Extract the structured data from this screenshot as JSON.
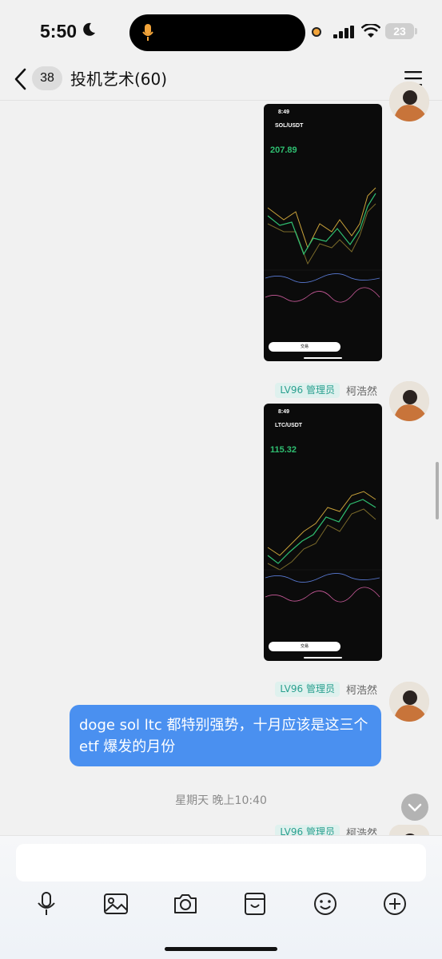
{
  "status": {
    "time": "5:50",
    "battery": "23"
  },
  "nav": {
    "unread": "38",
    "title": "投机艺术(60)"
  },
  "messages": {
    "sender_name": "柯浩然",
    "role": "LV96 管理员",
    "img1": {
      "time": "8:49",
      "pair": "SOL/USDT",
      "price": "207.89",
      "button": "交易"
    },
    "img2": {
      "time": "8:49",
      "pair": "LTC/USDT",
      "price": "115.32",
      "button": "交易"
    },
    "text": "doge sol ltc 都特别强势，十月应该是这三个 etf 爆发的月份"
  },
  "date_separator": "星期天 晚上10:40",
  "toolbar": [
    "mic-icon",
    "image-icon",
    "camera-icon",
    "sticker-box-icon",
    "emoji-icon",
    "plus-icon"
  ]
}
